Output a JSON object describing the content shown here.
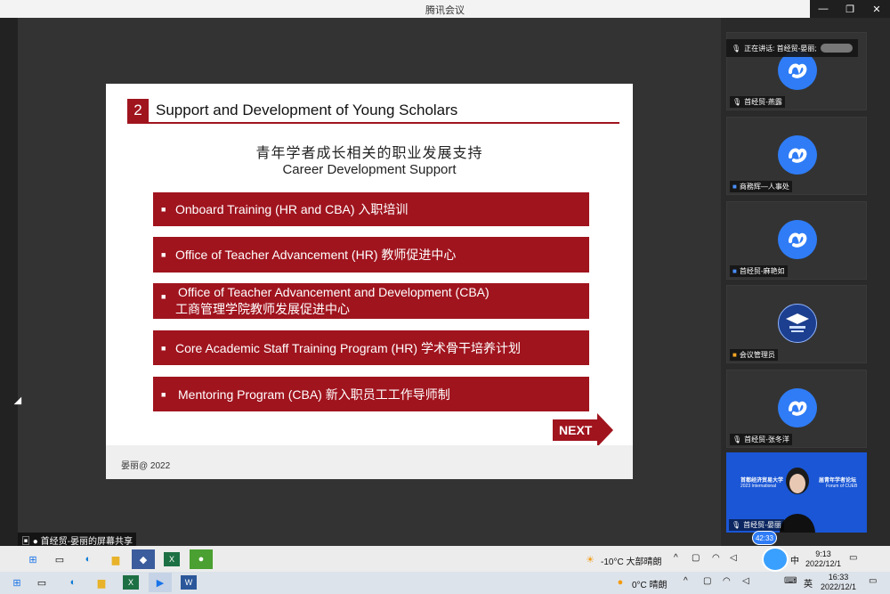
{
  "window": {
    "title": "腾讯会议",
    "controls": {
      "minimize": "—",
      "restore": "❐",
      "close": "✕"
    }
  },
  "slide": {
    "number": "2",
    "title": "Support and Development of Young Scholars",
    "subtitle_cn": "青年学者成长相关的职业发展支持",
    "subtitle_en": "Career Development Support",
    "items": [
      {
        "line1": "Onboard Training (HR and CBA) 入职培训",
        "line2": ""
      },
      {
        "line1": "Office of Teacher Advancement (HR) 教师促进中心",
        "line2": ""
      },
      {
        "line1": "Office of Teacher Advancement and Development (CBA)",
        "line2": "工商管理学院教师发展促进中心"
      },
      {
        "line1": "Core Academic Staff Training Program (HR) 学术骨干培养计划",
        "line2": ""
      },
      {
        "line1": "Mentoring Program  (CBA) 新入职员工工作导师制",
        "line2": ""
      }
    ],
    "bullet": "■",
    "next_label": "NEXT",
    "footer": "晏丽@ 2022",
    "accent_color": "#a0141e"
  },
  "share_label": "首经贸-晏丽的屏幕共享",
  "speaking": {
    "label": "正在讲话: 首经贸-晏丽;"
  },
  "participants": [
    {
      "name": "首经贸-燕露",
      "role": "avatar"
    },
    {
      "name": "商務辉—人事处",
      "role": "avatar"
    },
    {
      "name": "首经贸-麻艳如",
      "role": "avatar"
    },
    {
      "name": "会议管理员",
      "role": "logo"
    },
    {
      "name": "首经贸-张冬洋",
      "role": "avatar"
    },
    {
      "name": "首经贸-晏丽",
      "role": "video"
    }
  ],
  "video_banner": {
    "line1": "首都经济贸易大学",
    "line2": "届青年学者论坛",
    "line3": "2023 International",
    "line4": "Forum of CUEB"
  },
  "meeting_timer": "42:33",
  "taskbar_top": {
    "weather": "-10°C  大部晴朗",
    "ime": "中",
    "time": "9:13",
    "date": "2022/12/1"
  },
  "taskbar_bottom": {
    "weather": "0°C  晴朗",
    "ime": "英",
    "time": "16:33",
    "date": "2022/12/1"
  }
}
